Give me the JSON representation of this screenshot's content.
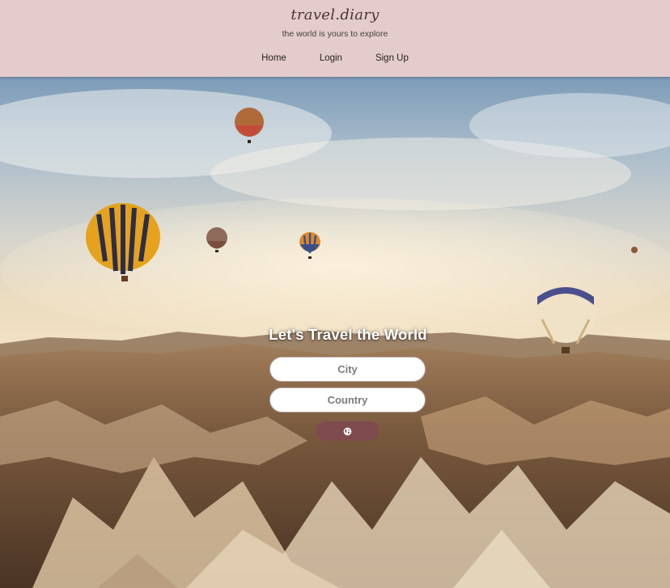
{
  "header": {
    "brand": "travel.diary",
    "tagline": "the world is yours to explore",
    "nav": [
      {
        "label": "Home"
      },
      {
        "label": "Login"
      },
      {
        "label": "Sign Up"
      }
    ]
  },
  "hero": {
    "background_image": "hot-air-balloons-over-rock-valley",
    "headline": "Let's Travel the World",
    "city_placeholder": "City",
    "country_placeholder": "Country",
    "submit_icon": "globe-icon"
  },
  "colors": {
    "header_bg": "#e3cccb",
    "button_bg": "#7f4a4e",
    "headline": "#ffffff"
  }
}
